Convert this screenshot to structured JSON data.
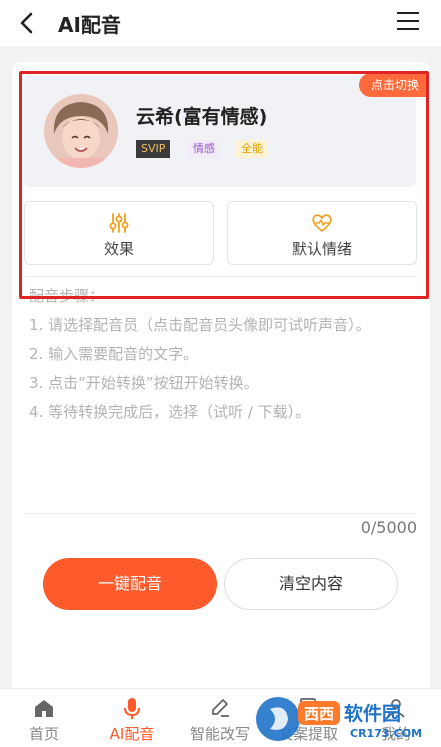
{
  "header": {
    "title": "AI配音"
  },
  "voice": {
    "switch_label": "点击切换",
    "name": "云希(富有情感)",
    "badges": {
      "tier": "SVIP",
      "style": "情感",
      "scope": "全能"
    }
  },
  "options": {
    "effect_label": "效果",
    "mood_label": "默认情绪"
  },
  "steps": {
    "heading": "配音步骤：",
    "step1": "1. 请选择配音员（点击配音员头像即可试听声音）。",
    "step2": "2. 输入需要配音的文字。",
    "step3": "3. 点击“开始转换”按钮开始转换。",
    "step4": "4. 等待转换完成后，选择（试听 / 下载）。"
  },
  "counter": "0/5000",
  "actions": {
    "primary": "一键配音",
    "secondary": "清空内容"
  },
  "tabs": [
    {
      "label": "首页",
      "icon": "home-icon"
    },
    {
      "label": "AI配音",
      "icon": "microphone-icon"
    },
    {
      "label": "智能改写",
      "icon": "edit-icon"
    },
    {
      "label": "文案提取",
      "icon": "document-icon"
    },
    {
      "label": "我的",
      "icon": "user-icon"
    }
  ],
  "watermark": {
    "text": "西西软件园",
    "url": "CR173.COM"
  },
  "colors": {
    "accent": "#ff5a2b",
    "highlight": "#e02424",
    "tag": "#ff6a3d"
  }
}
